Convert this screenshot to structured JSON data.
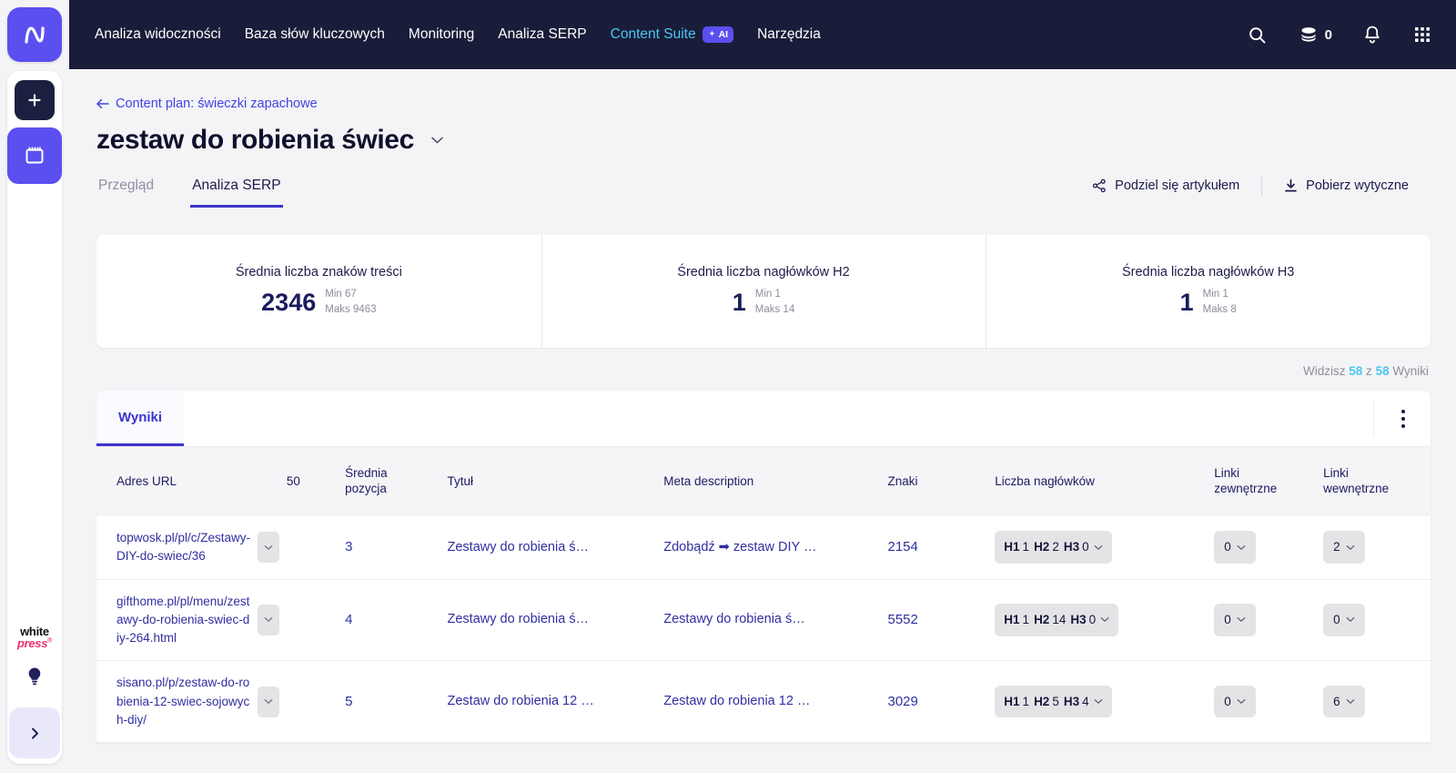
{
  "brand": {
    "rail_logo": "senuto-n-logo",
    "whitepress_white": "white",
    "whitepress_press": "press",
    "whitepress_reg": "®"
  },
  "topnav": {
    "items": [
      {
        "label": "Analiza widoczności",
        "accent": false,
        "badge": null
      },
      {
        "label": "Baza słów kluczowych",
        "accent": false,
        "badge": null
      },
      {
        "label": "Monitoring",
        "accent": false,
        "badge": null
      },
      {
        "label": "Analiza SERP",
        "accent": false,
        "badge": null
      },
      {
        "label": "Content Suite",
        "accent": true,
        "badge": "AI"
      },
      {
        "label": "Narzędzia",
        "accent": false,
        "badge": null
      }
    ],
    "credits": "0",
    "icons": {
      "search": "search-icon",
      "coins": "coins-icon",
      "bell": "bell-icon",
      "grid": "grid-apps-icon"
    }
  },
  "breadcrumb": {
    "label": "Content plan: świeczki zapachowe"
  },
  "page": {
    "title": "zestaw do robienia świec"
  },
  "tabs": [
    {
      "label": "Przegląd",
      "active": false
    },
    {
      "label": "Analiza SERP",
      "active": true
    }
  ],
  "actions": {
    "share": "Podziel się artykułem",
    "download": "Pobierz wytyczne"
  },
  "stats": [
    {
      "label": "Średnia liczba znaków treści",
      "value": "2346",
      "min": "Min 67",
      "max": "Maks 9463"
    },
    {
      "label": "Średnia liczba nagłówków H2",
      "value": "1",
      "min": "Min 1",
      "max": "Maks 14"
    },
    {
      "label": "Średnia liczba nagłówków H3",
      "value": "1",
      "min": "Min 1",
      "max": "Maks 8"
    }
  ],
  "result_count": {
    "prefix": "Widzisz",
    "shown": "58",
    "middle": "z",
    "total": "58",
    "suffix": "Wyniki"
  },
  "panel": {
    "tab_label": "Wyniki",
    "menu_icon": "kebab-menu-icon"
  },
  "table": {
    "headers": {
      "url": "Adres URL",
      "keywords": "50",
      "position": "Średnia\npozycja",
      "position_l1": "Średnia",
      "position_l2": "pozycja",
      "title": "Tytuł",
      "meta": "Meta description",
      "chars": "Znaki",
      "headings": "Liczba nagłówków",
      "links_ext_l1": "Linki",
      "links_ext_l2": "zewnętrzne",
      "links_int_l1": "Linki",
      "links_int_l2": "wewnętrzne"
    },
    "rows": [
      {
        "url": "topwosk.pl/pl/c/Zestawy-DIY-do-swiec/36",
        "position": "3",
        "title": "Zestawy do robienia ś…",
        "meta": "Zdobądź ➡ zestaw DIY …",
        "chars": "2154",
        "h1": "1",
        "h2": "2",
        "h3": "0",
        "links_external": "0",
        "links_internal": "2"
      },
      {
        "url": "gifthome.pl/pl/menu/zestawy-do-robienia-swiec-diy-264.html",
        "position": "4",
        "title": "Zestawy do robienia ś…",
        "meta": "Zestawy do robienia ś…",
        "chars": "5552",
        "h1": "1",
        "h2": "14",
        "h3": "0",
        "links_external": "0",
        "links_internal": "0"
      },
      {
        "url": "sisano.pl/p/zestaw-do-robienia-12-swiec-sojowych-diy/",
        "position": "5",
        "title": "Zestaw do robienia 12 …",
        "meta": "Zestaw do robienia 12 …",
        "chars": "3029",
        "h1": "1",
        "h2": "5",
        "h3": "4",
        "links_external": "0",
        "links_internal": "6"
      }
    ],
    "h_labels": {
      "h1": "H1",
      "h2": "H2",
      "h3": "H3"
    }
  },
  "colors": {
    "topbar": "#191d39",
    "brand_purple": "#5b4ff0",
    "accent_blue": "#4ec5f1",
    "link": "#2f2fa0",
    "text_dark": "#1b1b4b"
  }
}
